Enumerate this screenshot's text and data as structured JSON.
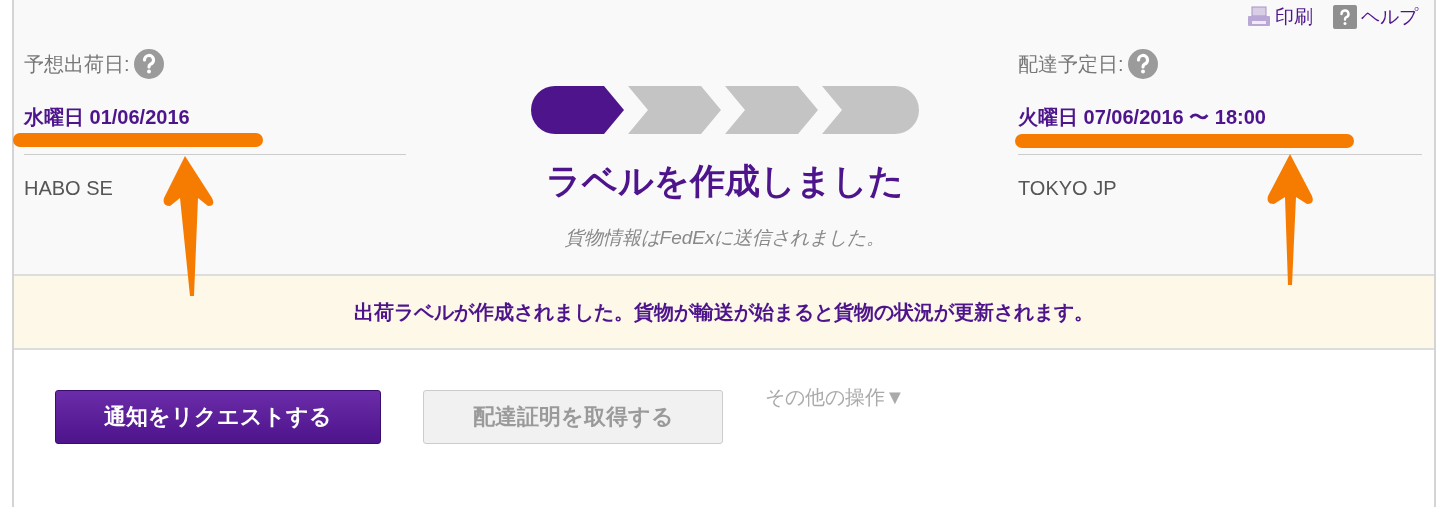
{
  "toolbar": {
    "links": [
      {
        "kind": "print",
        "label": "印刷"
      },
      {
        "kind": "help",
        "label": "ヘルプ"
      }
    ]
  },
  "ship": {
    "label": "予想出荷日:",
    "date": "水曜日 01/06/2016",
    "location": "HABO SE"
  },
  "progress": {
    "steps": [
      {
        "done": true
      },
      {
        "done": false
      },
      {
        "done": false
      },
      {
        "done": false
      }
    ],
    "status": "ラベルを作成しました",
    "note": "貨物情報はFedExに送信されました。"
  },
  "delivery": {
    "label": "配達予定日:",
    "date": "火曜日 07/06/2016 〜 18:00",
    "location": "TOKYO JP"
  },
  "banner": "出荷ラベルが作成されました。貨物が輸送が始まると貨物の状況が更新されます。",
  "actions": [
    {
      "label": "通知をリクエストする",
      "disabled": false
    },
    {
      "label": "配達証明を取得する",
      "disabled": true
    }
  ],
  "more_actions": "その他の操作▼"
}
